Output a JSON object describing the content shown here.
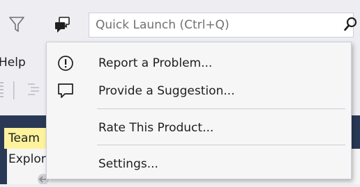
{
  "titlebar": {
    "filter_icon": "filter-funnel-icon",
    "feedback_icon": "send-feedback-icon",
    "quick_launch": {
      "placeholder": "Quick Launch (Ctrl+Q)",
      "search_icon": "search-magnifier-icon"
    }
  },
  "menubar": {
    "help_label": "Help"
  },
  "feedback_menu": {
    "items": [
      {
        "label": "Report a Problem...",
        "icon": "exclamation-circle-icon"
      },
      {
        "label": "Provide a Suggestion...",
        "icon": "speech-bubble-icon"
      },
      {
        "label": "Rate This Product..."
      },
      {
        "label": "Settings..."
      }
    ]
  },
  "team_explorer": {
    "tab_label": "Team Explorer"
  },
  "colors": {
    "chrome_background": "#EEEEF2",
    "menu_background": "#F6F6F6",
    "menu_border": "#CCCEDB",
    "ide_dark": "#293955",
    "active_tab": "#FFF29D"
  }
}
